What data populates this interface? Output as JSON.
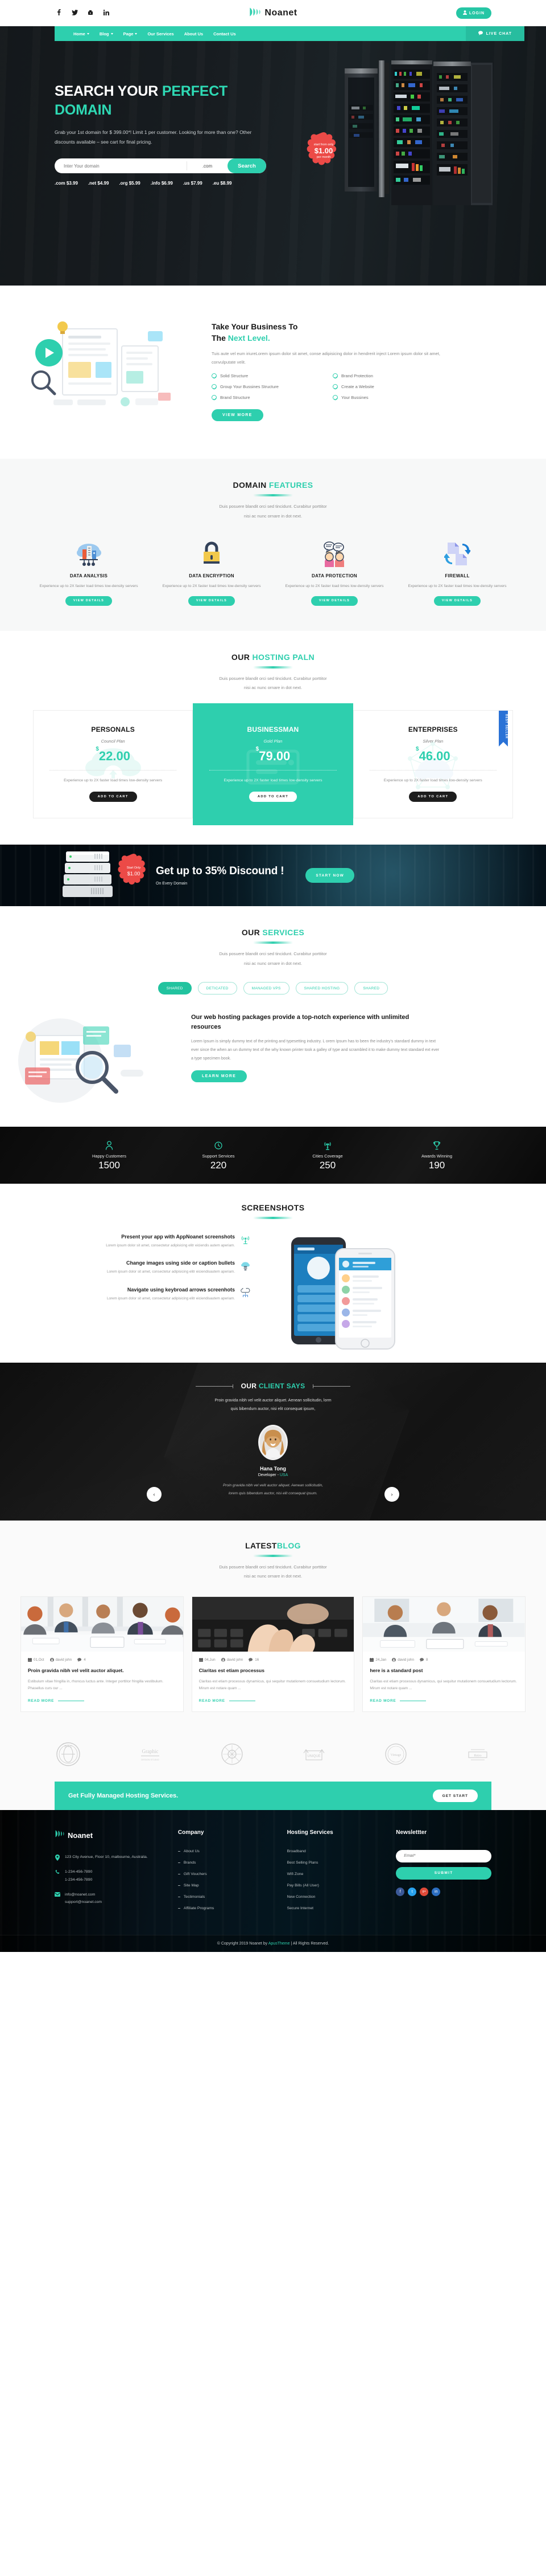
{
  "topbar": {
    "social": [
      "f",
      "t",
      "y",
      "in"
    ],
    "brand": "Noanet",
    "login_label": "LOGIN"
  },
  "nav": {
    "items": [
      {
        "label": "Home",
        "caret": true
      },
      {
        "label": "Blog",
        "caret": true
      },
      {
        "label": "Page",
        "caret": true
      },
      {
        "label": "Our Services",
        "caret": false
      },
      {
        "label": "About Us",
        "caret": false
      },
      {
        "label": "Contact Us",
        "caret": false
      }
    ],
    "live_chat": "LIVE CHAT"
  },
  "hero": {
    "title_1": "SEARCH YOUR ",
    "title_accent_1": "PERFECT",
    "title_accent_2": "DOMAIN",
    "subtitle": "Grab your 1st domain for $ 399.00*! Limit 1 per customer. Looking for more than one? Other discounts available – see cart for final pricing.",
    "search_placeholder": "Inter Your domain",
    "search_value": "",
    "tld_selected": ".com",
    "search_button": "Search",
    "tld_prices": [
      ".com $3.99",
      ".net $4.99",
      ".org $5.99",
      ".info $6.99",
      ".us $7.99",
      ".eu $8.99"
    ],
    "badge": {
      "top": "start from only",
      "price": "$1.00",
      "bottom": "per month"
    }
  },
  "business": {
    "title_line1": "Take Your Business To",
    "title_line2_plain": "The ",
    "title_line2_accent": "Next Level.",
    "paragraph": "Tuis aute vel eum iriureLorem ipsum dolor sit amet, conse adipisicing dolor in hendrerit inject Lorem ipsum dolor sit amet, convulputate velit.",
    "list": [
      "Solid Structure",
      "Brand Protection",
      "Group Your Bussines Structure",
      "Create a Website",
      "Brand Structure",
      "Your Bussines"
    ],
    "button": "VIEW MORE"
  },
  "features": {
    "title_plain": "DOMAIN ",
    "title_accent": "FEATURES",
    "subtitle_line1": "Duis posuere blandit orci sed tincidunt. Curabitur porttitor",
    "subtitle_line2": "nisi ac nunc ornare in dot next.",
    "cards": [
      {
        "icon": "cloud-city-icon",
        "title": "DATA ANALYSIS",
        "desc": "Experience up to 2X faster load times low-density servers",
        "button": "VIEW DETAILS"
      },
      {
        "icon": "padlock-icon",
        "title": "DATA ENCRYPTION",
        "desc": "Experience up to 2X faster load times low-density servers",
        "button": "VIEW DETAILS"
      },
      {
        "icon": "people-chat-icon",
        "title": "DATA PROTECTION",
        "desc": "Experience up to 2X faster load times low-density servers",
        "button": "VIEW DETAILS"
      },
      {
        "icon": "file-transfer-icon",
        "title": "FIREWALL",
        "desc": "Experience up to 2X faster load times low-density servers",
        "button": "VIEW DETAILS"
      }
    ]
  },
  "pricing": {
    "title_plain": "OUR ",
    "title_accent": "HOSTING PALN",
    "subtitle_line1": "Duis posuere blandit orci sed tincidunt. Curabitur porttitor",
    "subtitle_line2": "nisi ac nunc ornare in dot next.",
    "ribbon": "BEST SELLER",
    "plans": [
      {
        "name": "PERSONALS",
        "plan": "Council Plan",
        "currency": "$",
        "price": "22.00",
        "desc": "Experience up to 2X faster load times low-density servers",
        "button": "ADD TO CART"
      },
      {
        "name": "BUSINESSMAN",
        "plan": "Gold Plan",
        "currency": "$",
        "price": "79.00",
        "desc": "Experience up to 2X faster load times low-density servers",
        "button": "ADD TO CART"
      },
      {
        "name": "ENTERPRISES",
        "plan": "Silver Plan",
        "currency": "$",
        "price": "46.00",
        "desc": "Experience up to 2X faster load times low-density servers",
        "button": "ADD TO CART"
      }
    ]
  },
  "discount": {
    "badge_top": "Start  Only",
    "badge_price": "$1.00",
    "headline": "Get up to 35% Discound !",
    "subline": "On Every Domain",
    "button": "START NOW"
  },
  "services": {
    "title_plain": "OUR ",
    "title_accent": "SERVICES",
    "subtitle_line1": "Duis posuere blandit orci sed tincidunt. Curabitur porttitor",
    "subtitle_line2": "nisi ac nunc ornare in dot next.",
    "tabs": [
      "SHARED",
      "DETICATED",
      "MANAGED VPS",
      "SHARED HOSTING",
      "SHARED"
    ],
    "active_tab": "SHARED",
    "heading": "Our web hosting packages provide a top-notch experience with unlimited resources",
    "paragraph": "Lorem Ipsum is simply dummy text of the printing and typesetting industry. L orem Ipsum has to been the industry's standard dummy in text ever since the when an un dummy text of the why known printer took a galley of type and scrambled it to make dummy text standard ext ever a type specimen book.",
    "button": "LEARN MORE"
  },
  "counters": [
    {
      "icon": "user-icon",
      "label": "Happy Customers",
      "value": "1500"
    },
    {
      "icon": "clock-icon",
      "label": "Support Services",
      "value": "220"
    },
    {
      "icon": "tower-icon",
      "label": "Cities Coverage",
      "value": "250"
    },
    {
      "icon": "trophy-icon",
      "label": "Awards Winning",
      "value": "190"
    }
  ],
  "screenshots": {
    "title": "SCREENSHOTS",
    "items": [
      {
        "icon": "signal-tower-icon",
        "heading": "Present your app with AppNoanet screenshots",
        "desc": "Lorem ipsum dolor sit amet, consectetur adipisicing elitr eiciendis autem aperiam."
      },
      {
        "icon": "cloud-server-icon",
        "heading": "Change images using side or caption bullets",
        "desc": "Lorem ipsum dolor sit amet, consectetur adipisicing elitr eiciendisautem aperiam."
      },
      {
        "icon": "cloud-network-icon",
        "heading": "Navigate using keybroad arrows screenhots",
        "desc": "Lorem ipsum dolor sit amet, consectetur adipisicing elitr eiciendisautem aperiam."
      }
    ]
  },
  "testimonial": {
    "title_plain": "OUR ",
    "title_accent": "CLIENT SAYS",
    "lead_line1": "Proin gravida nibh vel velit auctor aliquet. Aenean sollicitudin, lorm",
    "lead_line2": "quis bibendum auctor, nisi elit consequat ipsum,",
    "name": "Hana Tong",
    "role_plain": "Developer - ",
    "role_accent": "USA",
    "quote_line1": "Proin gravida nibh vel velit auctor aliquet. Aenean sollicitudin,",
    "quote_line2": "lorem quis bibendum auctor, nisi elit consequat ipsum.",
    "prev": "‹",
    "next": "›"
  },
  "blog": {
    "title_plain": "LATEST",
    "title_accent": "BLOG",
    "subtitle_line1": "Duis posuere blandit orci sed tincidunt. Curabitur porttitor",
    "subtitle_line2": "nisi ac nunc ornare in dot next.",
    "posts": [
      {
        "date": "01,Oct",
        "author": "david john",
        "comments": "4",
        "title": "Proin gravida nibh vel velit auctor aliquet.",
        "excerpt": "Estibulum vitae fringilla in, rhoncus luctus ante. Integer porttitor fringilla vestibulum. Phasellus curs our ...",
        "read_more": "READ MORE"
      },
      {
        "date": "04,Jun",
        "author": "david john",
        "comments": "16",
        "title": "Claritas est etiam processus",
        "excerpt": "Claritas est etiam processus dynamicus, qui sequitur mutationem consuetudium lectorum. Mirum est notare quam ...",
        "read_more": "READ MORE"
      },
      {
        "date": "24,Jan",
        "author": "david john",
        "comments": "8",
        "title": "here is a standard post",
        "excerpt": "Claritas est etiam processus dynamicus, qui sequitur mutationem consuetudium lectorum. Mirum est notare quam ...",
        "read_more": "READ MORE"
      }
    ]
  },
  "client_logos": [
    "BPFC",
    "Graphic",
    "Brand",
    "UNIQUE",
    "Vintage",
    "Retro"
  ],
  "cta": {
    "heading": "Get Fully Managed Hosting Services.",
    "button": "GET START"
  },
  "footer": {
    "brand": "Noanet",
    "address": "123 City Avenue, Floor 10, malbourne, Australia.",
    "phone1": "1-234-456-7890",
    "phone2": "1-234-456-7890",
    "email1": "info@noanet.com",
    "email2": "support@noanet.com",
    "company": {
      "title": "Company",
      "links": [
        "About Us",
        "Brands",
        "Gift Vouchers",
        "Site Map",
        "Testimonials",
        "Affiliate Programs"
      ]
    },
    "hosting": {
      "title": "Hosting Services",
      "links": [
        "Broadband",
        "Best Selling Plans",
        "Wifi Zone",
        "Pay Bills (All User)",
        "New Connection",
        "Secure Internet"
      ]
    },
    "newsletter": {
      "title": "Newslettter",
      "placeholder": "Email*",
      "value": "",
      "button": "SUBMIT",
      "socials": [
        "f",
        "t",
        "g+",
        "in"
      ]
    },
    "copyright_plain_1": "© Copyright 2019 Noanet by ",
    "copyright_accent": "ApusTheme",
    "copyright_plain_2": " | All Rights Reserved."
  },
  "colors": {
    "accent": "#2ecfae",
    "dark": "#151a1d",
    "red_badge": "#ec4a47",
    "ribbon_blue": "#2a72d6"
  }
}
